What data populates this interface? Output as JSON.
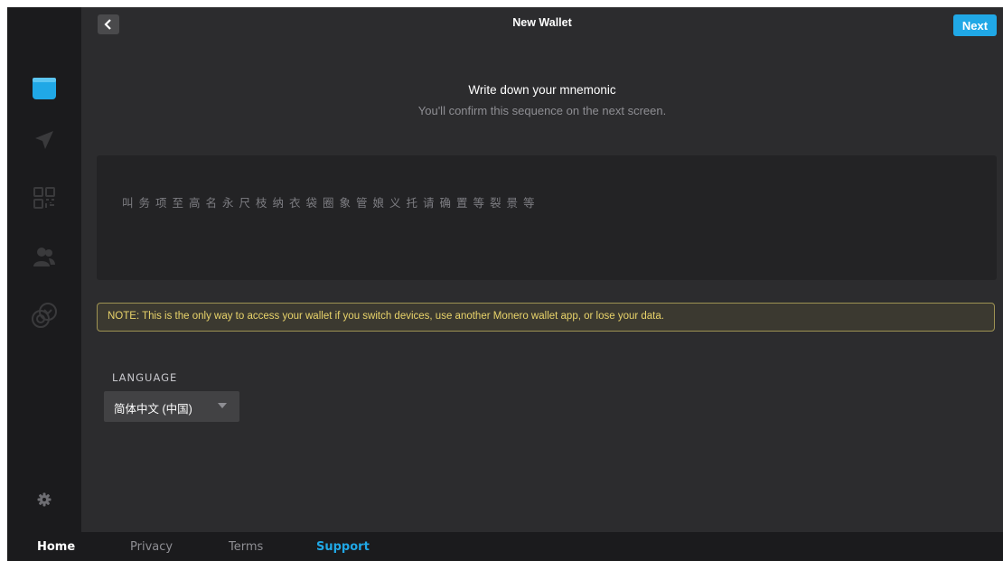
{
  "window": {
    "title": "New Wallet"
  },
  "toolbar": {
    "back_icon": "chevron-left-icon",
    "next_label": "Next"
  },
  "colors": {
    "accent": "#20a8e6",
    "sidebar_bg": "#1b1b1d",
    "main_bg": "#2c2c2e",
    "note_border": "#9e9353",
    "note_text": "#e8d36a"
  },
  "sidebar": {
    "items": [
      {
        "icon": "wallet-icon",
        "active": true
      },
      {
        "icon": "send-icon",
        "active": false
      },
      {
        "icon": "qr-code-icon",
        "active": false
      },
      {
        "icon": "contacts-icon",
        "active": false
      },
      {
        "icon": "monero-coins-icon",
        "active": false
      }
    ],
    "settings_icon": "gear-icon"
  },
  "main": {
    "heading": "Write down your mnemonic",
    "subheading": "You'll confirm this sequence on the next screen.",
    "mnemonic": "叫务项至高名永尺枝纳衣袋圈象管娘义托请确置等裂景等",
    "note": "NOTE: This is the only way to access your wallet if you switch devices, use another Monero wallet app, or lose your data.",
    "language": {
      "label": "LANGUAGE",
      "selected": "简体中文 (中国)"
    }
  },
  "footer": {
    "items": [
      "Home",
      "Privacy",
      "Terms",
      "Support"
    ]
  }
}
